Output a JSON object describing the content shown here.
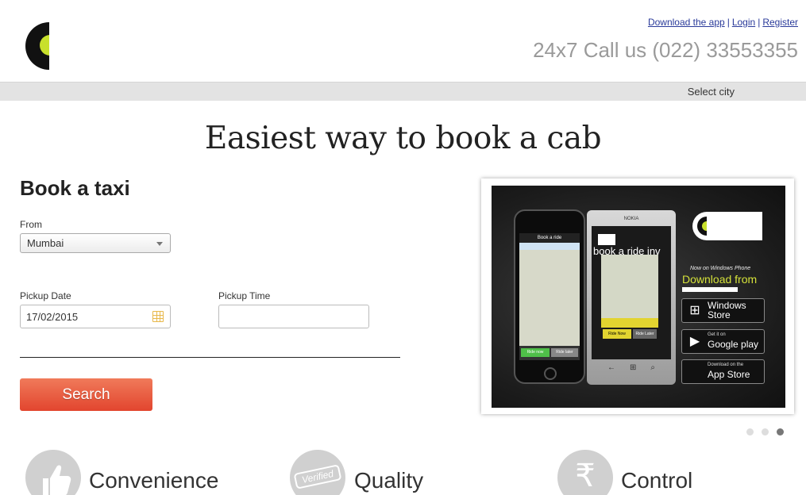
{
  "header": {
    "links": [
      "Download the app",
      "Login",
      "Register"
    ],
    "call_text": "24x7 Call us (022) 33553355",
    "city_select": "Select city"
  },
  "hero": {
    "title": "Easiest way to book a cab"
  },
  "booking_form": {
    "title": "Book a taxi",
    "from_label": "From",
    "from_value": "Mumbai",
    "pickup_date_label": "Pickup Date",
    "pickup_date_value": "17/02/2015",
    "pickup_time_label": "Pickup Time",
    "pickup_time_value": "",
    "search_label": "Search"
  },
  "banner": {
    "phone1_header": "Book a ride",
    "phone1_ride_now": "Ride now",
    "phone1_ride_later": "Ride later",
    "phone2_brand": "NOKIA",
    "phone2_title": "book a ride inv",
    "phone2_ride_now": "Ride Now",
    "phone2_ride_later": "Ride Later",
    "now_on": "Now on Windows Phone",
    "download_from": "Download from",
    "stores": [
      {
        "line1": "",
        "line2": "Windows Store",
        "icon": "windows-icon"
      },
      {
        "line1": "Get it on",
        "line2": "Google play",
        "icon": "google-play-icon"
      },
      {
        "line1": "Download on the",
        "line2": "App Store",
        "icon": "apple-icon"
      }
    ],
    "carousel_active_index": 2,
    "carousel_count": 3
  },
  "features": [
    {
      "label": "Convenience",
      "icon": "thumbs-up-icon"
    },
    {
      "label": "Quality",
      "icon": "verified-badge-icon",
      "badge_text": "Verified"
    },
    {
      "label": "Control",
      "icon": "rupee-icon",
      "glyph": "₹"
    }
  ],
  "colors": {
    "brand_lime": "#c8e02b",
    "search_button": "#e2452e",
    "link_blue": "#2a3a9a"
  }
}
